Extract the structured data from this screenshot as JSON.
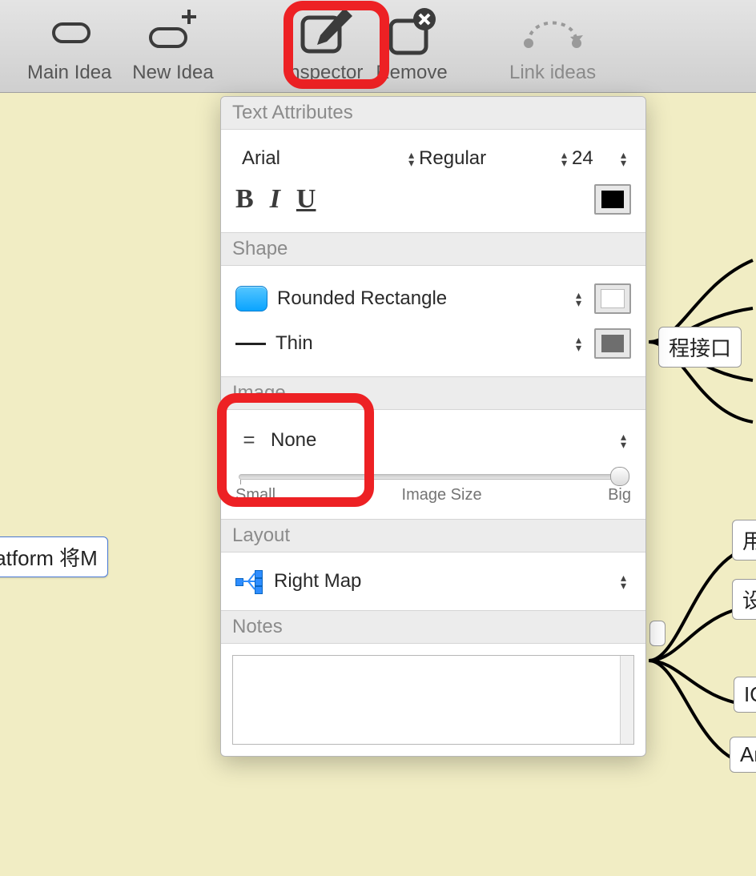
{
  "toolbar": {
    "main_idea": "Main Idea",
    "new_idea": "New Idea",
    "inspect": "Inspector",
    "remove": "Remove",
    "link": "Link ideas"
  },
  "inspector": {
    "text_attr_title": "Text Attributes",
    "font_family": "Arial",
    "font_style": "Regular",
    "font_size": "24",
    "bold": "B",
    "italic": "I",
    "underline": "U",
    "text_color": "#000000",
    "shape_title": "Shape",
    "shape_name": "Rounded Rectangle",
    "shape_fill": "#ffffff",
    "stroke_name": "Thin",
    "stroke_color": "#6e6e6e",
    "image_title": "Image",
    "image_name": "None",
    "size_small": "Small",
    "size_label": "Image Size",
    "size_big": "Big",
    "layout_title": "Layout",
    "layout_name": "Right Map",
    "notes_title": "Notes"
  },
  "map": {
    "main": "OM Platform 将M",
    "r1": "程接口",
    "r2": "用",
    "r3": "设",
    "r4": "IO",
    "r5": "An"
  }
}
